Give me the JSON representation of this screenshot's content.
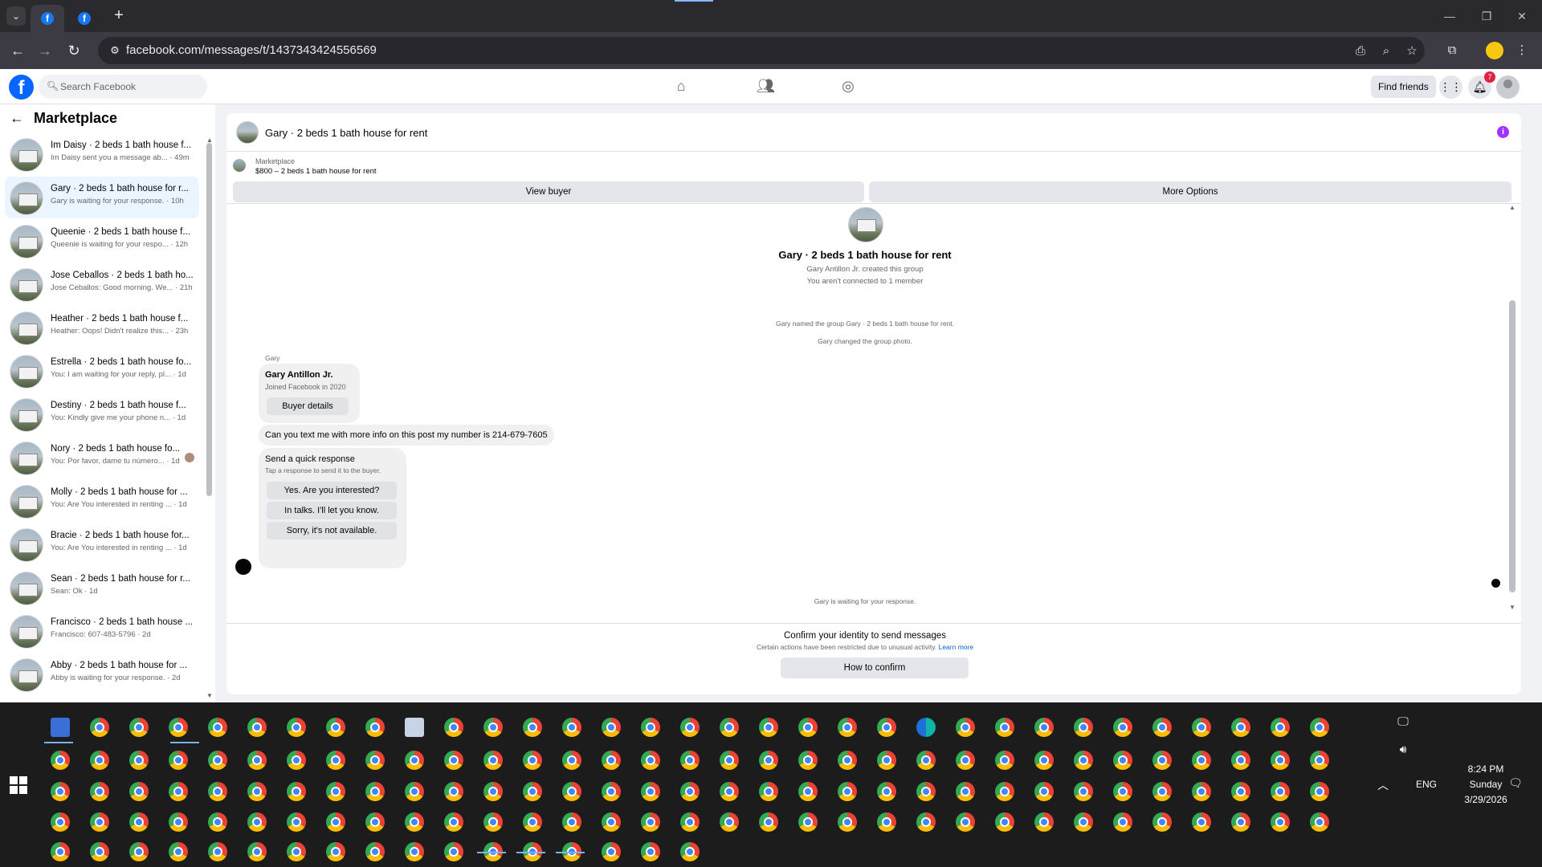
{
  "browser": {
    "url": "facebook.com/messages/t/1437343424556569",
    "new_tab_symbol": "+"
  },
  "fb_header": {
    "search_placeholder": "Search Facebook",
    "find_friends": "Find friends",
    "notification_count": "7"
  },
  "sidebar": {
    "title": "Marketplace",
    "conversations": [
      {
        "name": "Im Daisy · 2 beds 1 bath house f...",
        "preview": "Im Daisy sent you a message ab... · 49m"
      },
      {
        "name": "Gary · 2 beds 1 bath house for r...",
        "preview": "Gary is waiting for your response. · 10h"
      },
      {
        "name": "Queenie · 2 beds 1 bath house f...",
        "preview": "Queenie is waiting for your respo... · 12h"
      },
      {
        "name": "Jose Ceballos · 2 beds 1 bath ho...",
        "preview": "Jose Ceballos: Good morning. We... · 21h"
      },
      {
        "name": "Heather · 2 beds 1 bath house f...",
        "preview": "Heather: Oops! Didn't realize this... · 23h"
      },
      {
        "name": "Estrella · 2 beds 1 bath house fo...",
        "preview": "You: I am waiting for your reply, pl... · 1d"
      },
      {
        "name": "Destiny · 2 beds 1 bath house f...",
        "preview": "You: Kindly give me your phone n... · 1d"
      },
      {
        "name": "Nory · 2 beds 1 bath house fo...",
        "preview": "You: Por favor, dame tu número... · 1d"
      },
      {
        "name": "Molly · 2 beds 1 bath house for ...",
        "preview": "You: Are You interested in renting ... · 1d"
      },
      {
        "name": "Bracie · 2 beds 1 bath house for...",
        "preview": "You: Are You interested in renting ... · 1d"
      },
      {
        "name": "Sean · 2 beds 1 bath house for r...",
        "preview": "Sean: Ok · 1d"
      },
      {
        "name": "Francisco · 2 beds 1 bath house ...",
        "preview": "Francisco: 607-483-5796 · 2d"
      },
      {
        "name": "Abby · 2 beds 1 bath house for ...",
        "preview": "Abby is waiting for your response. · 2d"
      }
    ]
  },
  "chat": {
    "title": "Gary · 2 beds 1 bath house for rent",
    "listing_source": "Marketplace",
    "listing_price": "$800 – 2 beds 1 bath house for rent",
    "view_buyer": "View buyer",
    "more_options": "More Options",
    "group_name": "Gary · 2 beds 1 bath house for rent",
    "created_by": "Gary Antillon Jr. created this group",
    "connection": "You aren't connected to 1 member",
    "system_1": "Gary named the group Gary · 2 beds 1 bath house for rent.",
    "system_2": "Gary changed the group photo.",
    "sender": "Gary",
    "buyer_name": "Gary Antillon Jr.",
    "buyer_joined": "Joined Facebook in 2020",
    "buyer_details": "Buyer details",
    "message": "Can you text me with more info on this post my number is 214-679-7605",
    "quick_title": "Send a quick response",
    "quick_sub": "Tap a response to send it to the buyer.",
    "quick_1": "Yes. Are you interested?",
    "quick_2": "In talks. I'll let you know.",
    "quick_3": "Sorry, it's not available.",
    "waiting": "Gary is waiting for your response.",
    "confirm_title": "Confirm your identity to send messages",
    "confirm_sub": "Certain actions have been restricted due to unusual activity.",
    "learn_more": "Learn more",
    "how_to_confirm": "How to confirm"
  },
  "taskbar": {
    "time": "8:24 PM",
    "day": "Sunday",
    "date": "3/29/2026",
    "lang": "ENG"
  },
  "colors": {
    "fb_blue": "#0866ff",
    "info_purple": "#a033ff",
    "badge_red": "#e41e3f"
  }
}
